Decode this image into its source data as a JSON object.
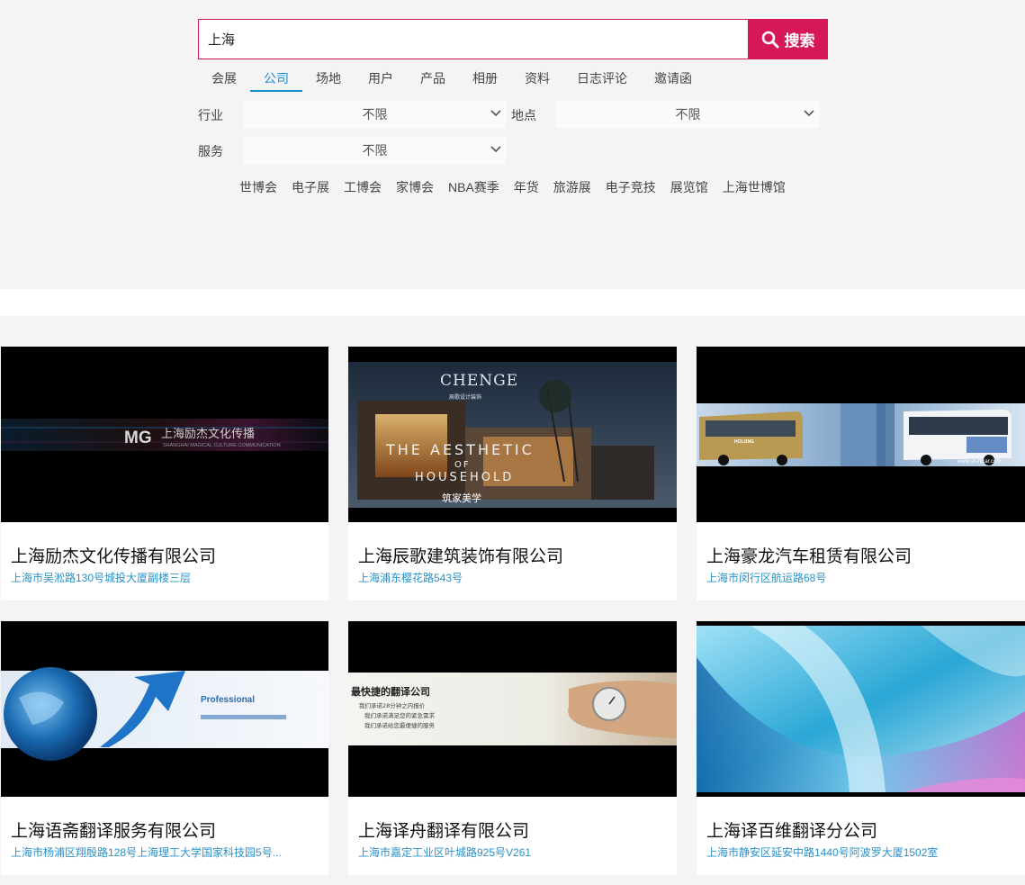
{
  "search": {
    "query": "上海",
    "button_label": "搜索"
  },
  "tabs": [
    "会展",
    "公司",
    "场地",
    "用户",
    "产品",
    "相册",
    "资料",
    "日志评论",
    "邀请函"
  ],
  "active_tab": "公司",
  "filters": {
    "industry": {
      "label": "行业",
      "value": "不限"
    },
    "location": {
      "label": "地点",
      "value": "不限"
    },
    "service": {
      "label": "服务",
      "value": "不限"
    }
  },
  "hot_keywords": [
    "世博会",
    "电子展",
    "工博会",
    "家博会",
    "NBA赛季",
    "年货",
    "旅游展",
    "电子竞技",
    "展览馆",
    "上海世博馆"
  ],
  "companies": [
    {
      "name": "上海励杰文化传播有限公司",
      "address": "上海市吴淞路130号城投大厦副楼三层",
      "banner_text": "上海励杰文化传播",
      "banner_sub": "SHANGHAI MAGICAL CULTURE COMMUNICATION",
      "logo_text": "MG"
    },
    {
      "name": "上海辰歌建筑装饰有限公司",
      "address": "上海浦东樱花路543号",
      "banner_brand": "CHENGE",
      "banner_tag": "辰歌设计装饰",
      "banner_line1": "THE AESTHETIC",
      "banner_line2": "OF",
      "banner_line3": "HOUSEHOLD",
      "banner_cn": "筑家美学"
    },
    {
      "name": "上海豪龙汽车租赁有限公司",
      "address": "上海市闵行区航运路68号",
      "banner_brand": "HOLONG",
      "banner_url": "www.sh-hlcar.com"
    },
    {
      "name": "上海语斋翻译服务有限公司",
      "address": "上海市杨浦区翔殷路128号上海理工大学国家科技园5号...",
      "banner_word": "Professional"
    },
    {
      "name": "上海译舟翻译有限公司",
      "address": "上海市嘉定工业区叶城路925号V261",
      "banner_title": "最快捷的翻译公司",
      "banner_l1": "我们承诺28分钟之内报价",
      "banner_l2": "我们承诺满足您的紧急需求",
      "banner_l3": "我们承诺给您最便捷的服务"
    },
    {
      "name": "上海译百维翻译分公司",
      "address": "上海市静安区延安中路1440号阿波罗大厦1502室"
    }
  ],
  "colors": {
    "accent": "#d6185a",
    "tab_active": "#1a8fd0",
    "address": "#2a91c9"
  }
}
